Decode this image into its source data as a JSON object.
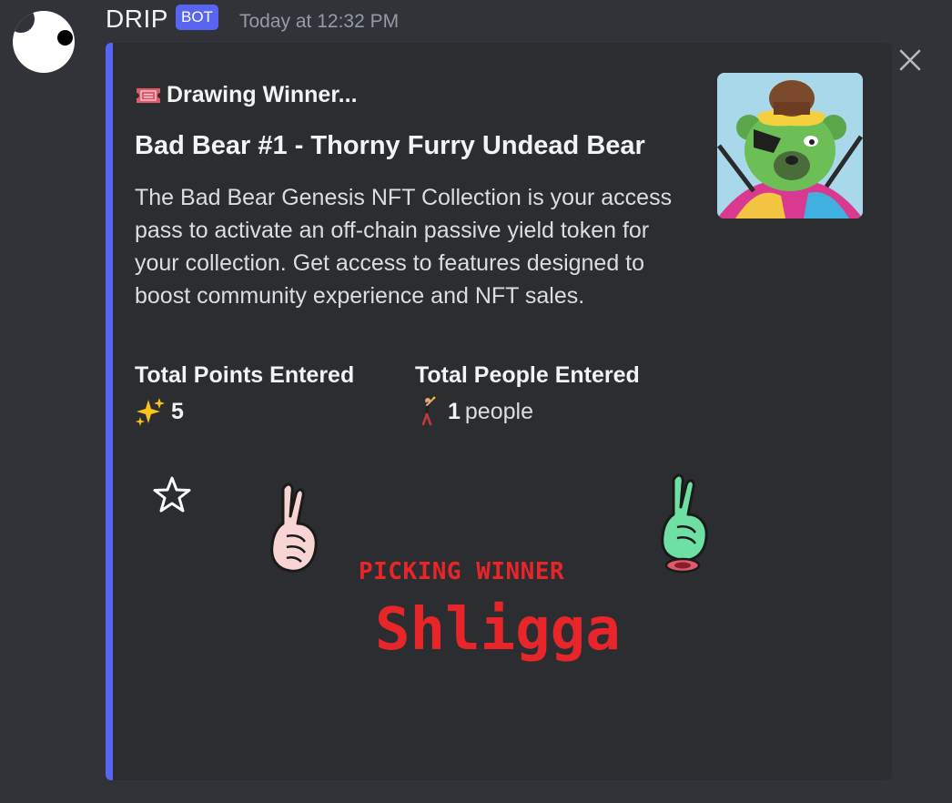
{
  "message": {
    "username": "DRIP",
    "bot_tag": "BOT",
    "timestamp": "Today at 12:32 PM"
  },
  "embed": {
    "accent_color": "#5865f2",
    "author": {
      "icon": "admit-one-ticket-icon",
      "text": "Drawing Winner..."
    },
    "title": "Bad Bear #1 - Thorny Furry Undead Bear",
    "description": "The Bad Bear Genesis NFT Collection is your access pass to activate an off-chain passive yield token for your collection. Get access to features designed to boost community experience and NFT sales.",
    "thumbnail": "bad-bear-nft-thumbnail",
    "fields": [
      {
        "name": "Total Points Entered",
        "icon": "sparkles-icon",
        "value": "5",
        "unit": ""
      },
      {
        "name": "Total People Entered",
        "icon": "man-dancing-icon",
        "value": "1",
        "unit": "people"
      }
    ],
    "image": {
      "label": "PICKING WINNER",
      "winner": "Shligga",
      "text_color": "#e8262a"
    }
  },
  "icons": {
    "close": "close-icon",
    "star": "star-icon",
    "left_hand": "crossed-fingers-icon",
    "right_hand": "crossed-fingers-icon"
  }
}
